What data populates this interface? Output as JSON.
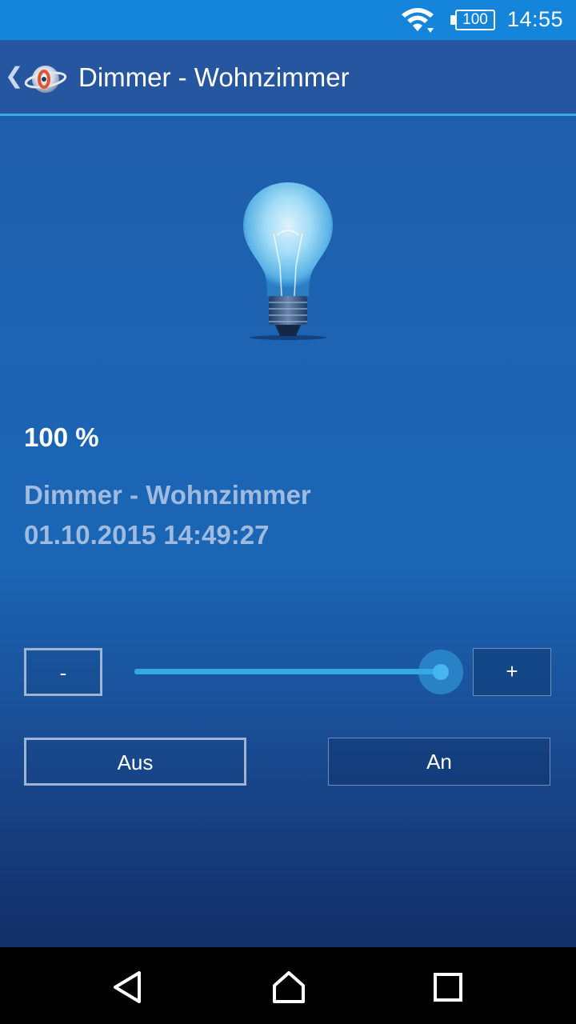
{
  "status_bar": {
    "battery": "100",
    "time": "14:55",
    "icons": [
      "wifi-icon",
      "battery-icon"
    ]
  },
  "action_bar": {
    "title": "Dimmer - Wohnzimmer",
    "back_icon": "chevron-left-icon",
    "logo_icon": "app-logo-icon"
  },
  "device": {
    "level_text": "100 %",
    "level": 100,
    "name": "Dimmer - Wohnzimmer",
    "timestamp": "01.10.2015 14:49:27"
  },
  "controls": {
    "minus_label": "-",
    "plus_label": "+",
    "off_label": "Aus",
    "on_label": "An"
  },
  "navigation": {
    "icons": [
      "back-icon",
      "home-icon",
      "recent-apps-icon"
    ]
  },
  "colors": {
    "status_bar": "#1585db",
    "action_bar": "#2656a0",
    "accent": "#35a8e4",
    "secondary_text": "#9fbbe0"
  }
}
